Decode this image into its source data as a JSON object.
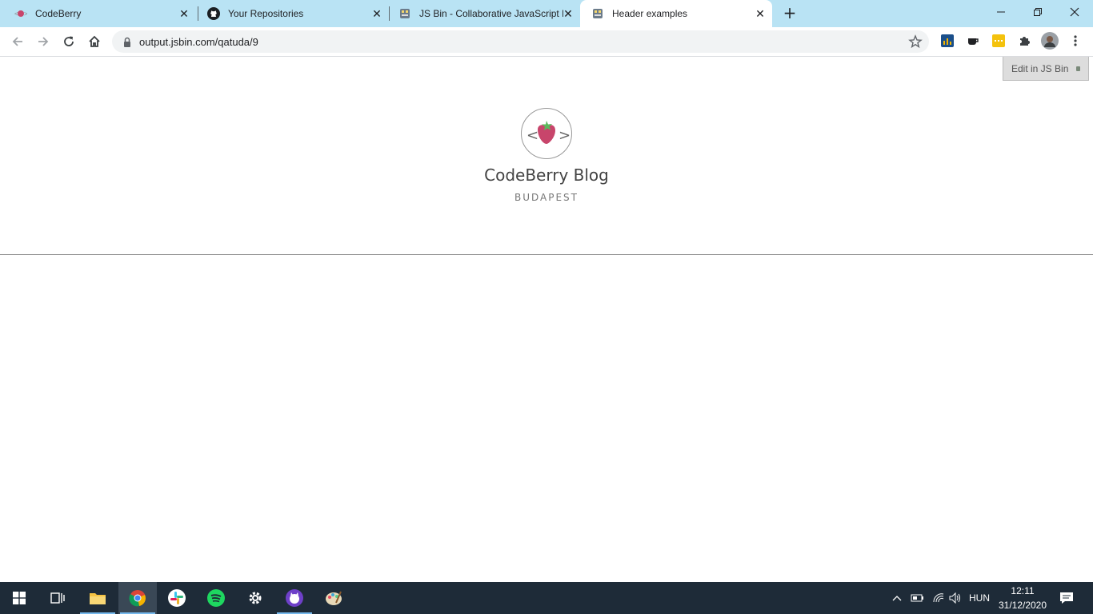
{
  "browser": {
    "tabs": [
      {
        "title": "CodeBerry",
        "icon": "codeberry-icon",
        "active": false
      },
      {
        "title": "Your Repositories",
        "icon": "github-icon",
        "active": false
      },
      {
        "title": "JS Bin - Collaborative JavaScript D",
        "icon": "jsbin-icon",
        "active": false
      },
      {
        "title": "Header examples",
        "icon": "jsbin-icon",
        "active": true
      }
    ],
    "new_tab": "+",
    "url": "output.jsbin.com/qatuda/9"
  },
  "page": {
    "edit_button": "Edit in JS Bin",
    "blog_title": "CodeBerry Blog",
    "location": "BUDAPEST"
  },
  "taskbar": {
    "language": "HUN",
    "time": "12:11",
    "date": "31/12/2020"
  },
  "colors": {
    "tabbar": "#b9e3f4",
    "berry": "#c8456b",
    "leaf": "#5cb85c",
    "taskbar": "#1e2b38"
  }
}
